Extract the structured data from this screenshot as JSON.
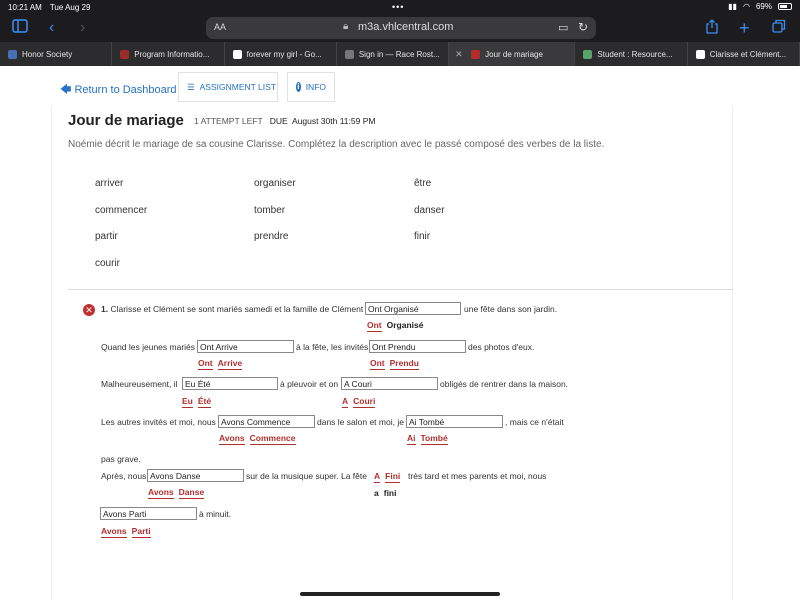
{
  "status": {
    "time": "10:21 AM",
    "date": "Tue Aug 29",
    "battery": "69%",
    "battery_level": 0.69
  },
  "browser": {
    "aa": "AA",
    "url": "m3a.vhlcentral.com"
  },
  "tabs": [
    {
      "label": "Honor Society",
      "color": "#4a6fb5"
    },
    {
      "label": "Program Informatio...",
      "color": "#9b2c2c"
    },
    {
      "label": "forever my girl - Go...",
      "color": "#ffffff"
    },
    {
      "label": "Sign in — Race Rost...",
      "color": "#777777"
    },
    {
      "label": "Jour de mariage",
      "color": "#b32d2d"
    },
    {
      "label": "Student : Resource...",
      "color": "#5aa36a"
    },
    {
      "label": "Clarisse et Clément...",
      "color": "#ffffff"
    }
  ],
  "nav": {
    "back": "Return to Dashboard",
    "assignment_list": "ASSIGNMENT LIST",
    "info": "INFO"
  },
  "header": {
    "title": "Jour de mariage",
    "attempts": "1 ATTEMPT LEFT",
    "due_label": "DUE",
    "due_date": "August 30th 11:59 PM"
  },
  "instructions": "Noémie décrit le mariage de sa cousine Clarisse. Complétez la description avec le passé composé des verbes de la liste.",
  "word_bank": [
    "arriver",
    "organiser",
    "être",
    "commencer",
    "tomber",
    "danser",
    "partir",
    "prendre",
    "finir",
    "courir"
  ],
  "question": {
    "number": "1.",
    "s1a": "Clarisse et Clément se sont mariés samedi et la famille de Clément",
    "a1": "Ont Organisé",
    "s1b": "une fête dans son jardin.",
    "c1": [
      "Ont",
      "Organisé"
    ],
    "s2a": "Quand les jeunes mariés",
    "a2": "Ont Arrive",
    "c2": [
      "Ont",
      "Arrive"
    ],
    "s2b": "à la fête, les invités",
    "a3": "Ont Prendu",
    "c3": [
      "Ont",
      "Prendu"
    ],
    "s2c": "des photos d'eux.",
    "s3a": "Malheureusement, il",
    "a4": "Eu Été",
    "c4": [
      "Eu",
      "Été"
    ],
    "s3b": "à pleuvoir et on",
    "a5": "A Couri",
    "c5": [
      "A",
      "Couri"
    ],
    "s3c": "obligés de rentrer dans la maison.",
    "s4a": "Les autres invités et moi, nous",
    "a6": "Avons Commence",
    "c6": [
      "Avons",
      "Commence"
    ],
    "s4b": "dans le salon et moi, je",
    "a7": "Ai Tombé",
    "c7": [
      "Ai",
      "Tombé"
    ],
    "s4c": ", mais ce n'était",
    "s5": "pas grave.",
    "s6a": "Après, nous",
    "a8": "Avons Danse",
    "c8": [
      "Avons",
      "Danse"
    ],
    "s6b": "sur de la musique super. La fête",
    "a9_top": [
      "A",
      "Fini"
    ],
    "a9_bottom": [
      "a",
      "fini"
    ],
    "s6c": "très tard et mes parents et moi, nous",
    "a10": "Avons Parti",
    "c10": [
      "Avons",
      "Parti"
    ],
    "s7": "à minuit."
  }
}
